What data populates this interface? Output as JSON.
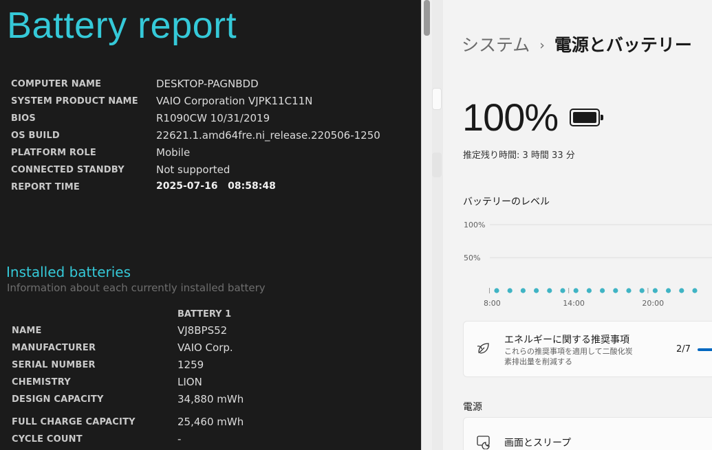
{
  "report": {
    "title": "Battery report",
    "system_info": [
      {
        "label": "COMPUTER NAME",
        "value": "DESKTOP-PAGNBDD"
      },
      {
        "label": "SYSTEM PRODUCT NAME",
        "value": "VAIO Corporation VJPK11C11N"
      },
      {
        "label": "BIOS",
        "value": "R1090CW 10/31/2019"
      },
      {
        "label": "OS BUILD",
        "value": "22621.1.amd64fre.ni_release.220506-1250"
      },
      {
        "label": "PLATFORM ROLE",
        "value": "Mobile"
      },
      {
        "label": "CONNECTED STANDBY",
        "value": "Not supported"
      },
      {
        "label": "REPORT TIME",
        "value": "2025-07-16   08:58:48"
      }
    ],
    "installed_section": {
      "title": "Installed batteries",
      "subtitle": "Information about each currently installed battery",
      "column": "BATTERY 1",
      "rows": [
        {
          "label": "NAME",
          "value": "VJ8BPS52"
        },
        {
          "label": "MANUFACTURER",
          "value": "VAIO Corp."
        },
        {
          "label": "SERIAL NUMBER",
          "value": "1259"
        },
        {
          "label": "CHEMISTRY",
          "value": "LION"
        },
        {
          "label": "DESIGN CAPACITY",
          "value": "34,880 mWh"
        },
        {
          "label": "FULL CHARGE CAPACITY",
          "value": "25,460 mWh"
        },
        {
          "label": "CYCLE COUNT",
          "value": "-"
        }
      ]
    }
  },
  "settings": {
    "breadcrumb": {
      "parent": "システム",
      "separator": "›",
      "current": "電源とバッテリー"
    },
    "battery_percent": "100%",
    "battery_icon": "battery-full-icon",
    "remaining_time": "推定残り時間: 3 時間 33 分",
    "battery_level_title": "バッテリーのレベル",
    "energy_card": {
      "icon": "leaf-icon",
      "title": "エネルギーに関する推奨事項",
      "description": "これらの推奨事項を適用して二酸化炭素排出量を削減する",
      "count": "2/7",
      "progress_fraction": 0.29
    },
    "power_heading": "電源",
    "screen_sleep_card": {
      "icon": "screen-sleep-icon",
      "title": "画面とスリープ"
    },
    "accent_color": "#0067c0"
  },
  "chart_data": {
    "type": "scatter",
    "title": "バッテリーのレベル",
    "y_ticks": [
      "100%",
      "50%"
    ],
    "x_ticks": [
      "8:00",
      "14:00",
      "20:00"
    ],
    "ylim": [
      0,
      100
    ],
    "points_color": "#40b4c4",
    "series": [
      {
        "x": [
          "8:00",
          "9:00",
          "10:00",
          "11:00",
          "12:00",
          "13:00",
          "14:00",
          "15:00",
          "16:00",
          "17:00",
          "18:00",
          "19:00",
          "20:00",
          "21:00",
          "22:00",
          "23:00"
        ],
        "values": [
          0,
          0,
          0,
          0,
          0,
          0,
          0,
          0,
          0,
          0,
          0,
          0,
          0,
          0,
          0,
          0
        ]
      }
    ],
    "grid": true
  }
}
